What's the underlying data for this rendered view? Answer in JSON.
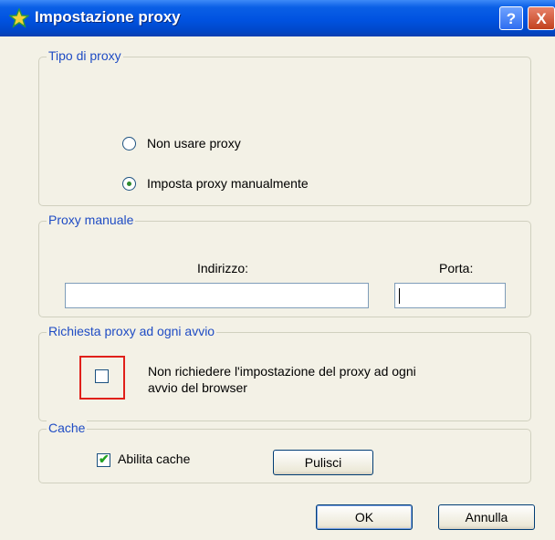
{
  "window": {
    "title": "Impostazione proxy",
    "help_label": "?",
    "close_label": "X"
  },
  "proxy_type": {
    "legend": "Tipo di proxy",
    "options": [
      {
        "label": "Non usare proxy",
        "selected": false
      },
      {
        "label": "Imposta proxy manualmente",
        "selected": true
      }
    ]
  },
  "manual_proxy": {
    "legend": "Proxy manuale",
    "address_label": "Indirizzo:",
    "address_value": "",
    "port_label": "Porta:",
    "port_value": ""
  },
  "startup_prompt": {
    "legend": "Richiesta proxy ad ogni avvio",
    "checkbox_label_line1": "Non richiedere l'impostazione del proxy ad ogni",
    "checkbox_label_line2": "avvio del browser",
    "checked": false
  },
  "cache": {
    "legend": "Cache",
    "enable_label": "Abilita cache",
    "enabled": true,
    "clear_button": "Pulisci"
  },
  "footer": {
    "ok_button": "OK",
    "cancel_button": "Annulla"
  },
  "colors": {
    "title_bar": "#0052e0",
    "legend_text": "#1f4cc4",
    "highlight": "#e0201a",
    "check": "#21a121"
  }
}
